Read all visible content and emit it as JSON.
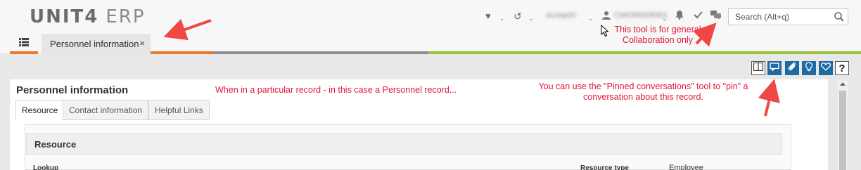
{
  "header": {
    "logo_main": "UNIT4",
    "logo_sub": "ERP",
    "user_company": "Acrwp00",
    "user_name": "CWORKER001",
    "search_placeholder": "Search (Alt+q)"
  },
  "tabs": [
    {
      "label": "Personnel information",
      "close": "×"
    }
  ],
  "page": {
    "title": "Personnel information",
    "record_tabs": [
      "Resource",
      "Contact information",
      "Helpful Links"
    ],
    "section_title": "Resource",
    "fields": [
      {
        "label": "Lookup",
        "value": ""
      },
      {
        "label": "Resource type",
        "value": "Employee"
      }
    ]
  },
  "actions": {
    "help_label": "?"
  },
  "annotations": {
    "collab_line1": "This tool is for general",
    "collab_line2": "Collaboration  only",
    "record_note": "When in a particular record - in this case a Personnel record...",
    "pinned_line1": "You can use the \"Pinned conversations\" tool to \"pin\" a",
    "pinned_line2": "conversation about this record."
  },
  "colors": {
    "accent_blue": "#1e6aa3",
    "annotation_red": "#e2173a",
    "bar_orange": "#e87a2f",
    "bar_gray": "#8a8f95",
    "bar_green": "#9bc23c"
  }
}
